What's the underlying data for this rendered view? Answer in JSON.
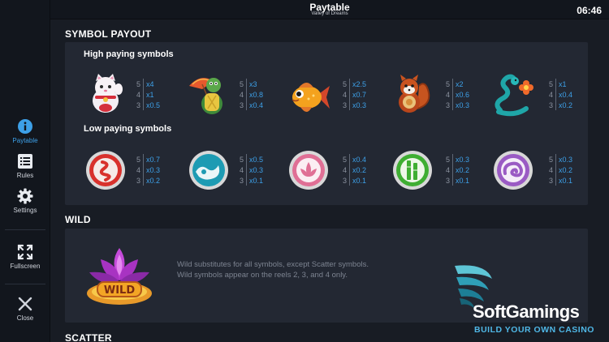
{
  "header": {
    "title": "Paytable",
    "subtitle": "Valley of Dreams",
    "clock": "06:46"
  },
  "sidebar": {
    "paytable": {
      "label": "Paytable",
      "icon": "info-icon"
    },
    "rules": {
      "label": "Rules",
      "icon": "list-icon"
    },
    "settings": {
      "label": "Settings",
      "icon": "gear-icon"
    },
    "fullscreen": {
      "label": "Fullscreen",
      "icon": "fullscreen-icon"
    },
    "close": {
      "label": "Close",
      "icon": "close-icon"
    }
  },
  "symbol_payout": {
    "title": "SYMBOL PAYOUT",
    "high_title": "High paying symbols",
    "low_title": "Low paying symbols",
    "high": [
      {
        "icon": "lucky-cat-icon",
        "pays": [
          {
            "n": "5",
            "v": "x4"
          },
          {
            "n": "4",
            "v": "x1"
          },
          {
            "n": "3",
            "v": "x0.5"
          }
        ]
      },
      {
        "icon": "turtle-umbrella-icon",
        "pays": [
          {
            "n": "5",
            "v": "x3"
          },
          {
            "n": "4",
            "v": "x0.8"
          },
          {
            "n": "3",
            "v": "x0.4"
          }
        ]
      },
      {
        "icon": "goldfish-icon",
        "pays": [
          {
            "n": "5",
            "v": "x2.5"
          },
          {
            "n": "4",
            "v": "x0.7"
          },
          {
            "n": "3",
            "v": "x0.3"
          }
        ]
      },
      {
        "icon": "red-panda-icon",
        "pays": [
          {
            "n": "5",
            "v": "x2"
          },
          {
            "n": "4",
            "v": "x0.6"
          },
          {
            "n": "3",
            "v": "x0.3"
          }
        ]
      },
      {
        "icon": "snake-flower-icon",
        "pays": [
          {
            "n": "5",
            "v": "x1"
          },
          {
            "n": "4",
            "v": "x0.4"
          },
          {
            "n": "3",
            "v": "x0.2"
          }
        ]
      }
    ],
    "low": [
      {
        "icon": "red-fire-orb-icon",
        "color": "#d8312c",
        "pays": [
          {
            "n": "5",
            "v": "x0.7"
          },
          {
            "n": "4",
            "v": "x0.3"
          },
          {
            "n": "3",
            "v": "x0.2"
          }
        ]
      },
      {
        "icon": "teal-water-orb-icon",
        "color": "#1d9bb3",
        "pays": [
          {
            "n": "5",
            "v": "x0.5"
          },
          {
            "n": "4",
            "v": "x0.3"
          },
          {
            "n": "3",
            "v": "x0.1"
          }
        ]
      },
      {
        "icon": "pink-lotus-orb-icon",
        "color": "#e06f95",
        "pays": [
          {
            "n": "5",
            "v": "x0.4"
          },
          {
            "n": "4",
            "v": "x0.2"
          },
          {
            "n": "3",
            "v": "x0.1"
          }
        ]
      },
      {
        "icon": "green-bamboo-orb-icon",
        "color": "#3fae32",
        "pays": [
          {
            "n": "5",
            "v": "x0.3"
          },
          {
            "n": "4",
            "v": "x0.2"
          },
          {
            "n": "3",
            "v": "x0.1"
          }
        ]
      },
      {
        "icon": "purple-cloud-orb-icon",
        "color": "#9a5bc4",
        "pays": [
          {
            "n": "5",
            "v": "x0.3"
          },
          {
            "n": "4",
            "v": "x0.2"
          },
          {
            "n": "3",
            "v": "x0.1"
          }
        ]
      }
    ]
  },
  "wild": {
    "title": "WILD",
    "badge": "WILD",
    "lines": [
      "Wild substitutes for all symbols, except Scatter symbols.",
      "Wild symbols appear on the reels 2, 3, and 4 only."
    ]
  },
  "scatter": {
    "title": "SCATTER"
  },
  "watermark": {
    "brand": "SoftGamings",
    "tagline": "BUILD YOUR OWN CASINO"
  },
  "colors": {
    "accent": "#3da0e8",
    "panel": "#232833",
    "background": "#181c24"
  }
}
